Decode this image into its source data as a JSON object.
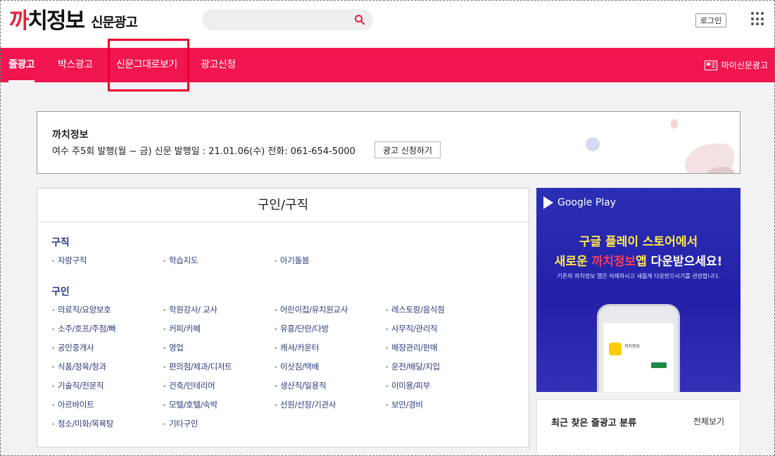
{
  "header": {
    "logo_main_red": "까",
    "logo_main_1": "치정",
    "logo_main_2": "보",
    "logo_sub": "신문광고",
    "search_placeholder": "",
    "login_label": "로그인"
  },
  "nav": {
    "items": [
      {
        "label": "줄광고",
        "active": true
      },
      {
        "label": "박스광고",
        "active": false
      },
      {
        "label": "신문그대로보기",
        "active": false
      },
      {
        "label": "광고신청",
        "active": false
      }
    ],
    "my_ads_label": "마이신문광고"
  },
  "info": {
    "title": "까치정보",
    "line": "여수 주5회 발행(월 ~ 금) 신문 발행일 : 21.01.06(수) 전화: 061-654-5000",
    "apply_label": "광고 신청하기"
  },
  "categories": {
    "title": "구인/구직",
    "section_jobseek": "구직",
    "jobseek_items": [
      "자랑구직",
      "학습지도",
      "아기돌봄"
    ],
    "section_hiring": "구인",
    "hiring_items": [
      "의료직/요양보호",
      "학원강사/ 교사",
      "어린이집/유치원교사",
      "레스토랑/음식점",
      "소주/호프/주점/빠",
      "커피/카페",
      "유흥/단란/다방",
      "사무직/관리직",
      "공인중개사",
      "영업",
      "캐셔/카운터",
      "매장관리/판매",
      "식품/정육/청과",
      "편의점/제과/디저트",
      "이삿짐/택배",
      "운전/배달/지입",
      "기술직/전문직",
      "건축/인테리어",
      "생산직/일용직",
      "이미용/피부",
      "아르바이트",
      "모텔/호텔/숙박",
      "선원/선장/기관사",
      "보안/경비",
      "청소/미화/목욕탕",
      "기타구인"
    ]
  },
  "gp_ad": {
    "store_name": "Google Play",
    "headline1": "구글 플레이 스토어에서",
    "headline2_a": "새로운 ",
    "headline2_b": "까치정보",
    "headline2_c": "앱",
    "headline2_d": " 다운받으세요!",
    "note": "기존의 까치정보 앱은 삭제하시고 새롭게 다운받으시기를 권장합니다.",
    "app_name": "까치정보"
  },
  "recent": {
    "title": "최근 찾은 줄광고 분류",
    "view_all": "전체보기"
  },
  "colors": {
    "nav_bg": "#f1164f",
    "brand_red": "#e8203d",
    "link_blue": "#2a3a7a",
    "highlight": "#e8002a",
    "ad_bg": "#2a2fb3"
  }
}
